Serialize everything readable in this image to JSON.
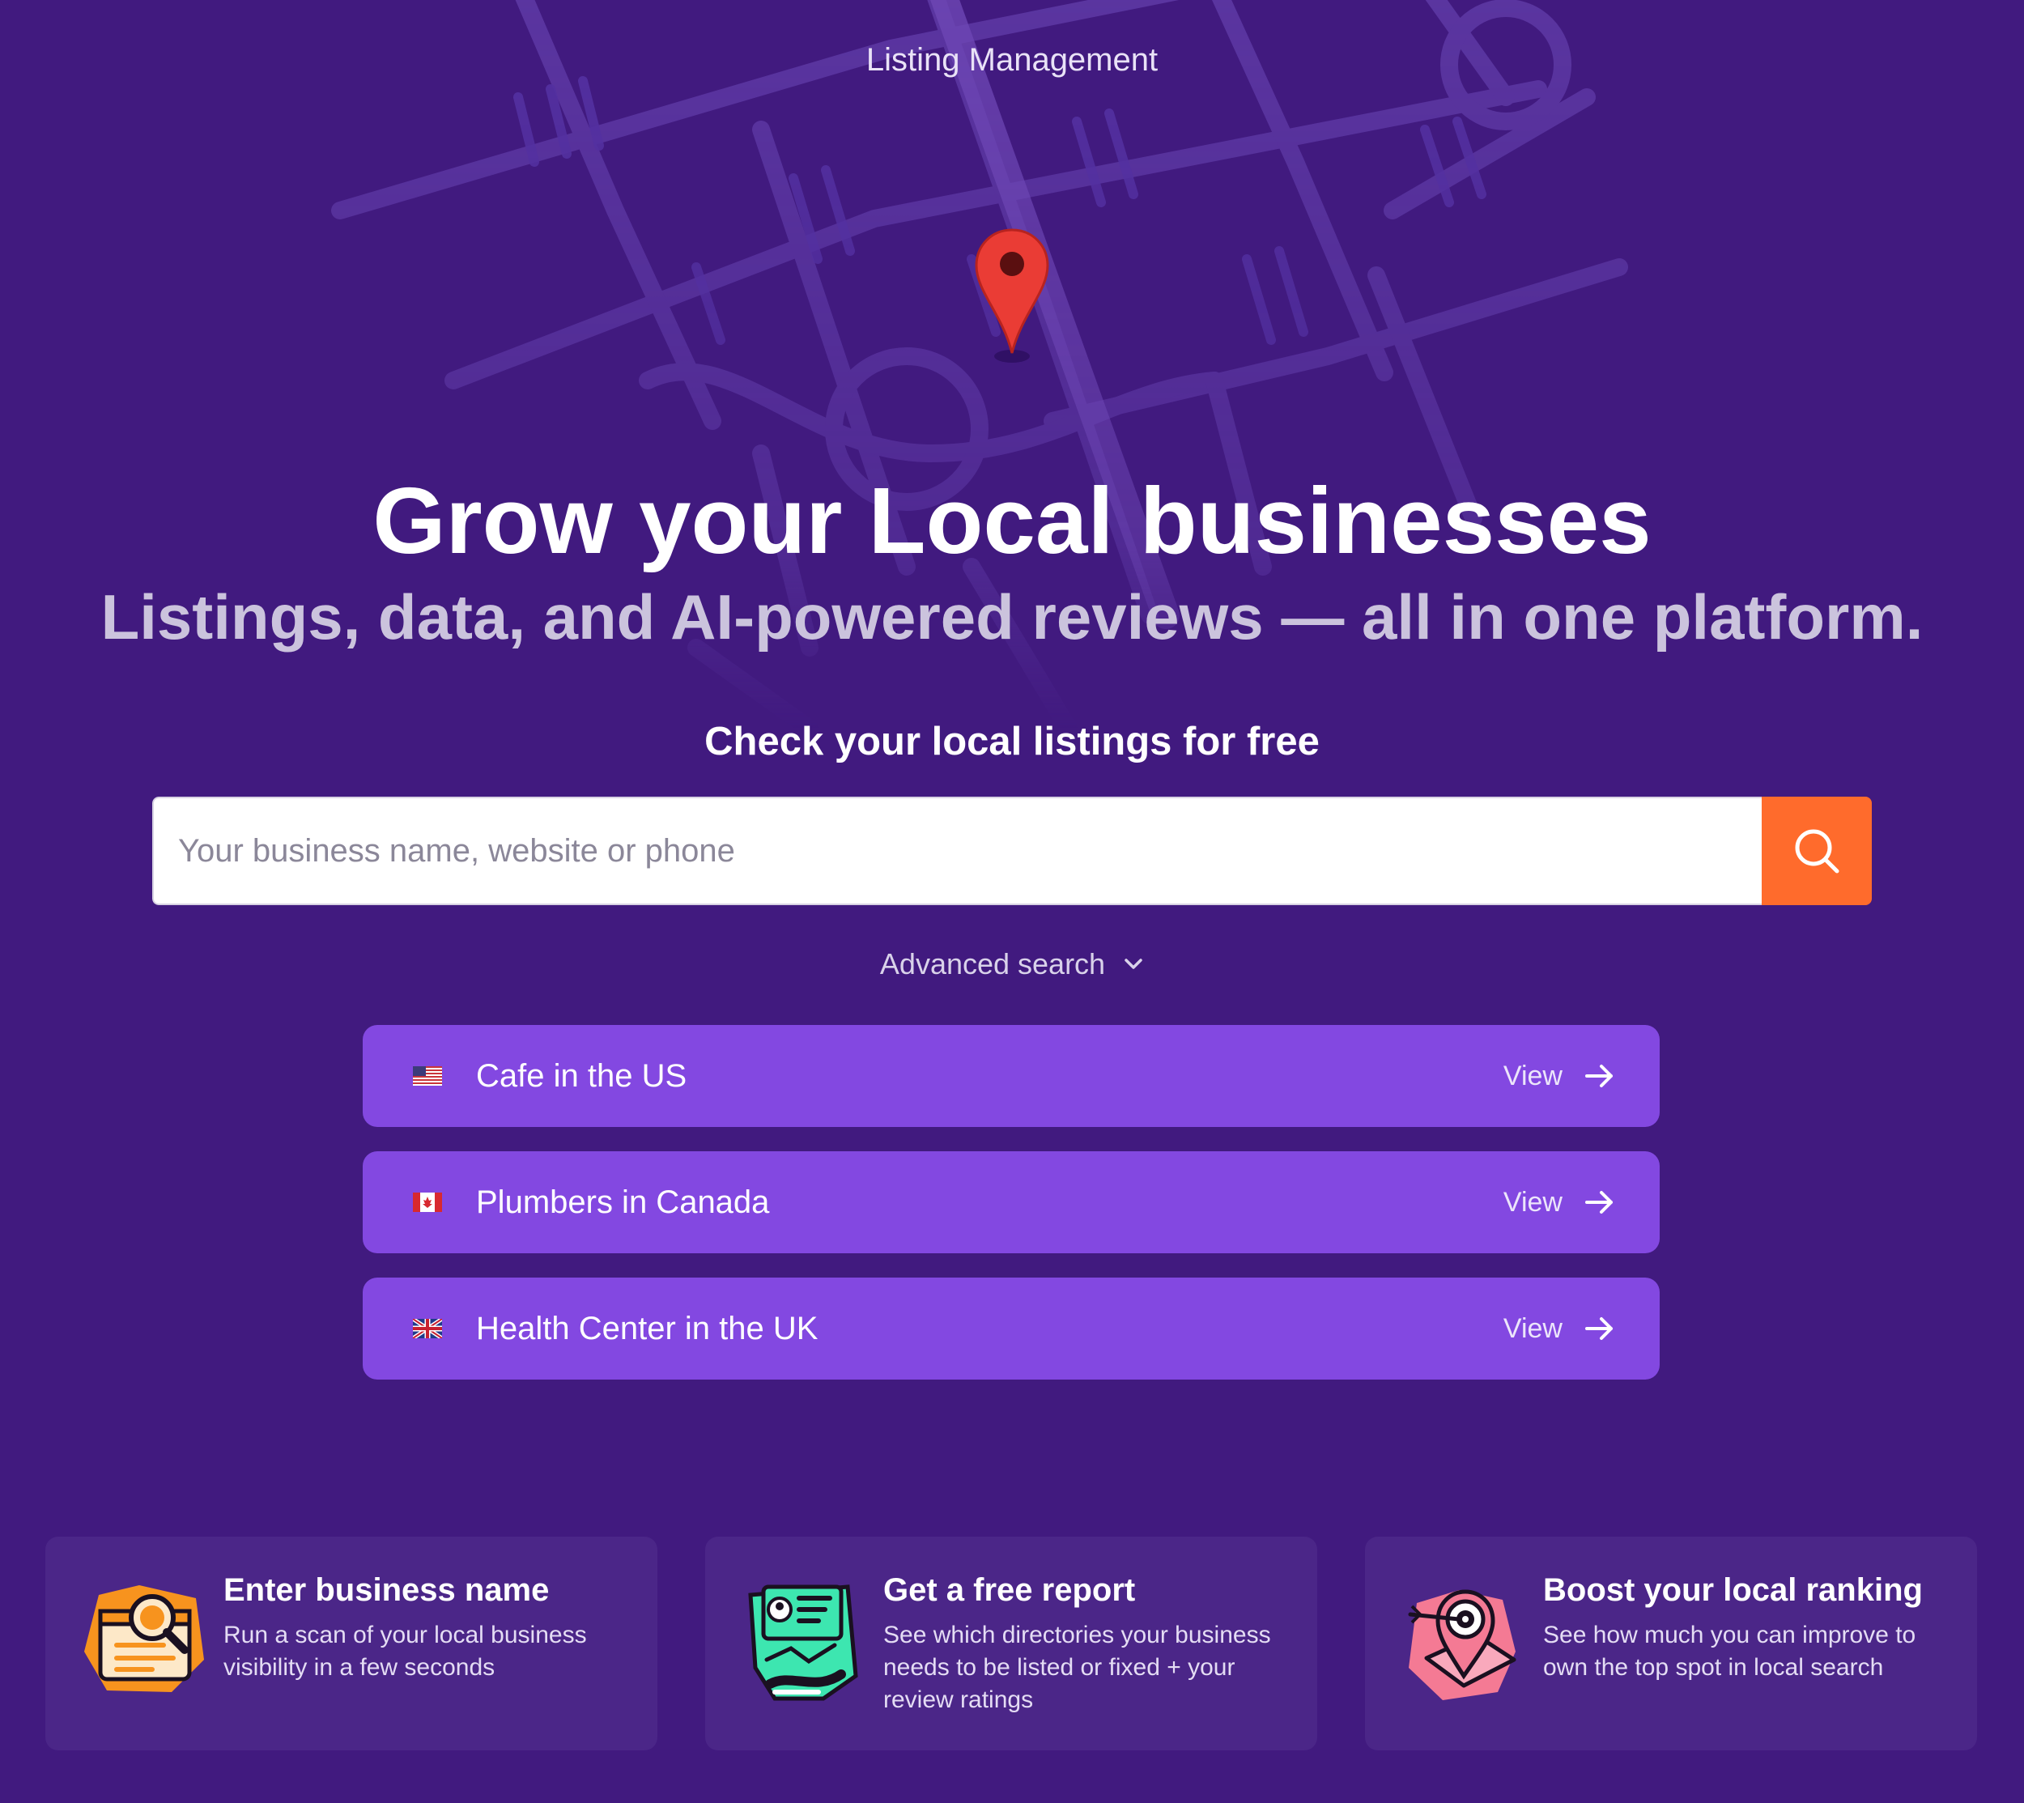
{
  "header": {
    "eyebrow": "Listing Management"
  },
  "hero": {
    "title": "Grow your Local businesses",
    "subtitle": "Listings, data, and AI-powered reviews — all in one platform."
  },
  "search": {
    "label": "Check your local listings for free",
    "placeholder": "Your business name, website or phone",
    "button_icon": "search-icon",
    "advanced_label": "Advanced search"
  },
  "examples": [
    {
      "flag": "us-flag-icon",
      "label": "Cafe in the US",
      "action": "View"
    },
    {
      "flag": "canada-flag-icon",
      "label": "Plumbers in Canada",
      "action": "View"
    },
    {
      "flag": "uk-flag-icon",
      "label": "Health Center in the UK",
      "action": "View"
    }
  ],
  "steps": [
    {
      "icon": "magnifier-browser-icon",
      "title": "Enter business name",
      "description": "Run a scan of your local business visibility in a few seconds"
    },
    {
      "icon": "report-document-icon",
      "title": "Get a free report",
      "description": "See which directories your business needs to be listed or fixed + your review ratings"
    },
    {
      "icon": "map-target-pin-icon",
      "title": "Boost your local ranking",
      "description": "See how much you can improve to own the top spot in local search"
    }
  ],
  "colors": {
    "background": "#411a7f",
    "accent_orange": "#ff6b2c",
    "row_purple": "#8348e1",
    "card_purple": "#4b2688",
    "pin_red": "#e8322f"
  }
}
